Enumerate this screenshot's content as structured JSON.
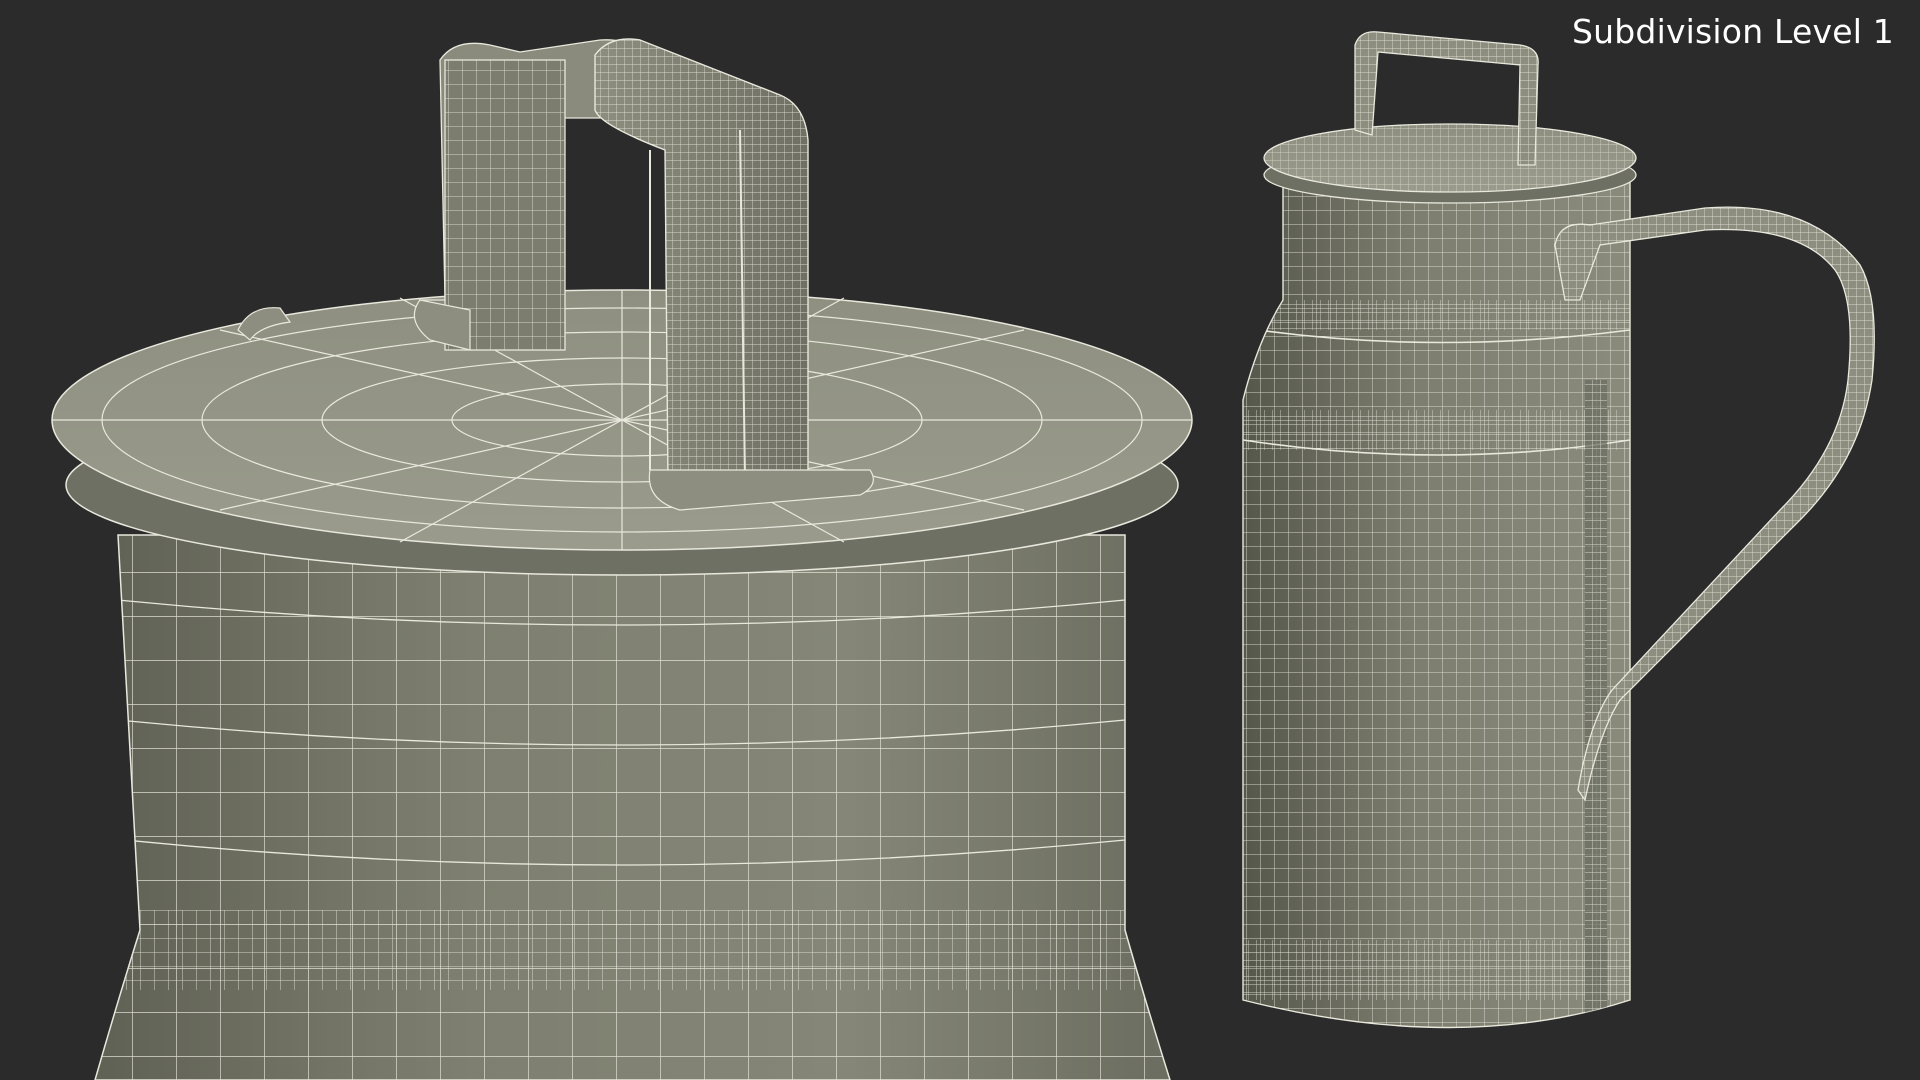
{
  "viewport": {
    "overlay_label": "Subdivision Level 1"
  },
  "colors": {
    "background": "#2b2b2b",
    "surface": "#7c7d6e",
    "surface_dark": "#55574b",
    "surface_light": "#9a9b8c",
    "wire": "#e8e8dc"
  }
}
